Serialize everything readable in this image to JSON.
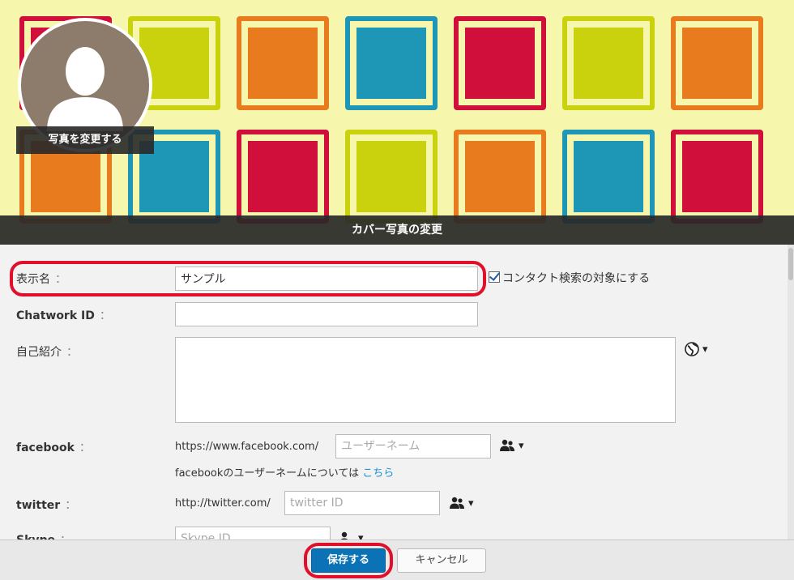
{
  "cover": {
    "change_cover_label": "カバー写真の変更",
    "change_photo_label": "写真を変更する",
    "colors": {
      "background": "#f6f7ad",
      "green": "#c9d20c",
      "orange": "#e87b1e",
      "blue": "#1e96b5",
      "red": "#d0103a"
    }
  },
  "form": {
    "display_name": {
      "label": "表示名",
      "value": "サンプル"
    },
    "contact_search": {
      "label": "コンタクト検索の対象にする",
      "checked": true
    },
    "chatwork_id": {
      "label": "Chatwork ID",
      "value": ""
    },
    "bio": {
      "label": "自己紹介",
      "value": ""
    },
    "facebook": {
      "label": "facebook",
      "prefix": "https://www.facebook.com/",
      "placeholder": "ユーザーネーム",
      "help_text": "facebookのユーザーネームについては",
      "help_link": "こちら"
    },
    "twitter": {
      "label": "twitter",
      "prefix": "http://twitter.com/",
      "placeholder": "twitter ID"
    },
    "skype": {
      "label": "Skype",
      "placeholder": "Skype ID"
    },
    "colon": "："
  },
  "footer": {
    "save_label": "保存する",
    "cancel_label": "キャンセル"
  },
  "highlight_color": "#e0102a",
  "icons": {
    "visibility_public": "globe-icon",
    "visibility_contacts": "people-icon",
    "dropdown": "caret-down-icon"
  }
}
